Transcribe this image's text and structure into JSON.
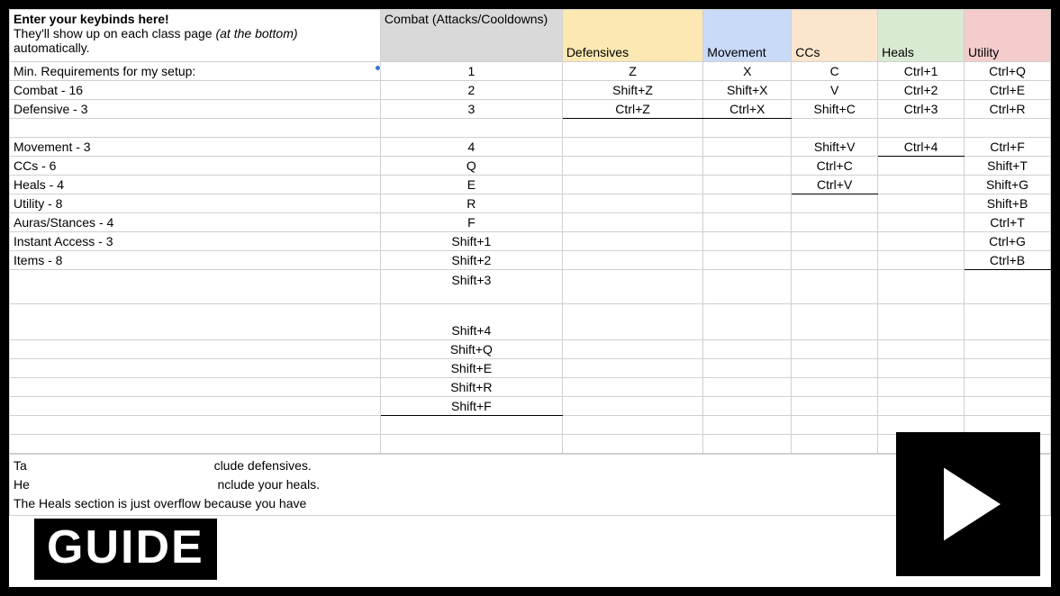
{
  "header": {
    "title": "Enter your keybinds here!",
    "subtitle_a": "They'll show up on each class page ",
    "subtitle_italic": "(at the bottom)",
    "subtitle_b": " automatically.",
    "columns": {
      "combat": "Combat (Attacks/Cooldowns)",
      "defensives": "Defensives",
      "movement": "Movement",
      "ccs": "CCs",
      "heals": "Heals",
      "utility": "Utility"
    }
  },
  "rows": [
    {
      "label": "Min. Requirements for my setup:",
      "combat": "1",
      "def": "Z",
      "mov": "X",
      "cc": "C",
      "heal": "Ctrl+1",
      "util": "Ctrl+Q"
    },
    {
      "label": "Combat - 16",
      "combat": "2",
      "def": "Shift+Z",
      "mov": "Shift+X",
      "cc": "V",
      "heal": "Ctrl+2",
      "util": "Ctrl+E"
    },
    {
      "label": "Defensive - 3",
      "combat": "3",
      "def": "Ctrl+Z",
      "mov": "Ctrl+X",
      "cc": "Shift+C",
      "heal": "Ctrl+3",
      "util": "Ctrl+R"
    },
    {
      "label": "",
      "combat": "",
      "def": "",
      "mov": "",
      "cc": "",
      "heal": "",
      "util": ""
    },
    {
      "label": "Movement - 3",
      "combat": "4",
      "def": "",
      "mov": "",
      "cc": "Shift+V",
      "heal": "Ctrl+4",
      "util": "Ctrl+F"
    },
    {
      "label": "CCs - 6",
      "combat": "Q",
      "def": "",
      "mov": "",
      "cc": "Ctrl+C",
      "heal": "",
      "util": "Shift+T"
    },
    {
      "label": "Heals - 4",
      "combat": "E",
      "def": "",
      "mov": "",
      "cc": "Ctrl+V",
      "heal": "",
      "util": "Shift+G"
    },
    {
      "label": "Utility - 8",
      "combat": "R",
      "def": "",
      "mov": "",
      "cc": "",
      "heal": "",
      "util": "Shift+B"
    },
    {
      "label": "Auras/Stances - 4",
      "combat": "F",
      "def": "",
      "mov": "",
      "cc": "",
      "heal": "",
      "util": "Ctrl+T"
    },
    {
      "label": "Instant Access - 3",
      "combat": "Shift+1",
      "def": "",
      "mov": "",
      "cc": "",
      "heal": "",
      "util": "Ctrl+G"
    },
    {
      "label": "Items - 8",
      "combat": "Shift+2",
      "def": "",
      "mov": "",
      "cc": "",
      "heal": "",
      "util": "Ctrl+B"
    },
    {
      "label": "",
      "combat": "Shift+3",
      "def": "",
      "mov": "",
      "cc": "",
      "heal": "",
      "util": "",
      "tall": "1"
    },
    {
      "label": "",
      "combat": "Shift+4",
      "def": "",
      "mov": "",
      "cc": "",
      "heal": "",
      "util": "",
      "tall2": "1"
    },
    {
      "label": "",
      "combat": "Shift+Q",
      "def": "",
      "mov": "",
      "cc": "",
      "heal": "",
      "util": ""
    },
    {
      "label": "",
      "combat": "Shift+E",
      "def": "",
      "mov": "",
      "cc": "",
      "heal": "",
      "util": ""
    },
    {
      "label": "",
      "combat": "Shift+R",
      "def": "",
      "mov": "",
      "cc": "",
      "heal": "",
      "util": ""
    },
    {
      "label": "",
      "combat": "Shift+F",
      "def": "",
      "mov": "",
      "cc": "",
      "heal": "",
      "util": ""
    },
    {
      "label": "",
      "combat": "",
      "def": "",
      "mov": "",
      "cc": "",
      "heal": "",
      "util": "",
      "blank": "1"
    },
    {
      "label": "",
      "combat": "",
      "def": "",
      "mov": "",
      "cc": "",
      "heal": "",
      "util": "",
      "blank": "1"
    }
  ],
  "footer": {
    "line1_a": "Ta",
    "line1_b": "clude defensives.",
    "line2_a": "He",
    "line2_b": "nclude your heals.",
    "line3": "The  Heals  section is just overflow because you have"
  },
  "badges": {
    "guide": "GUIDE"
  }
}
